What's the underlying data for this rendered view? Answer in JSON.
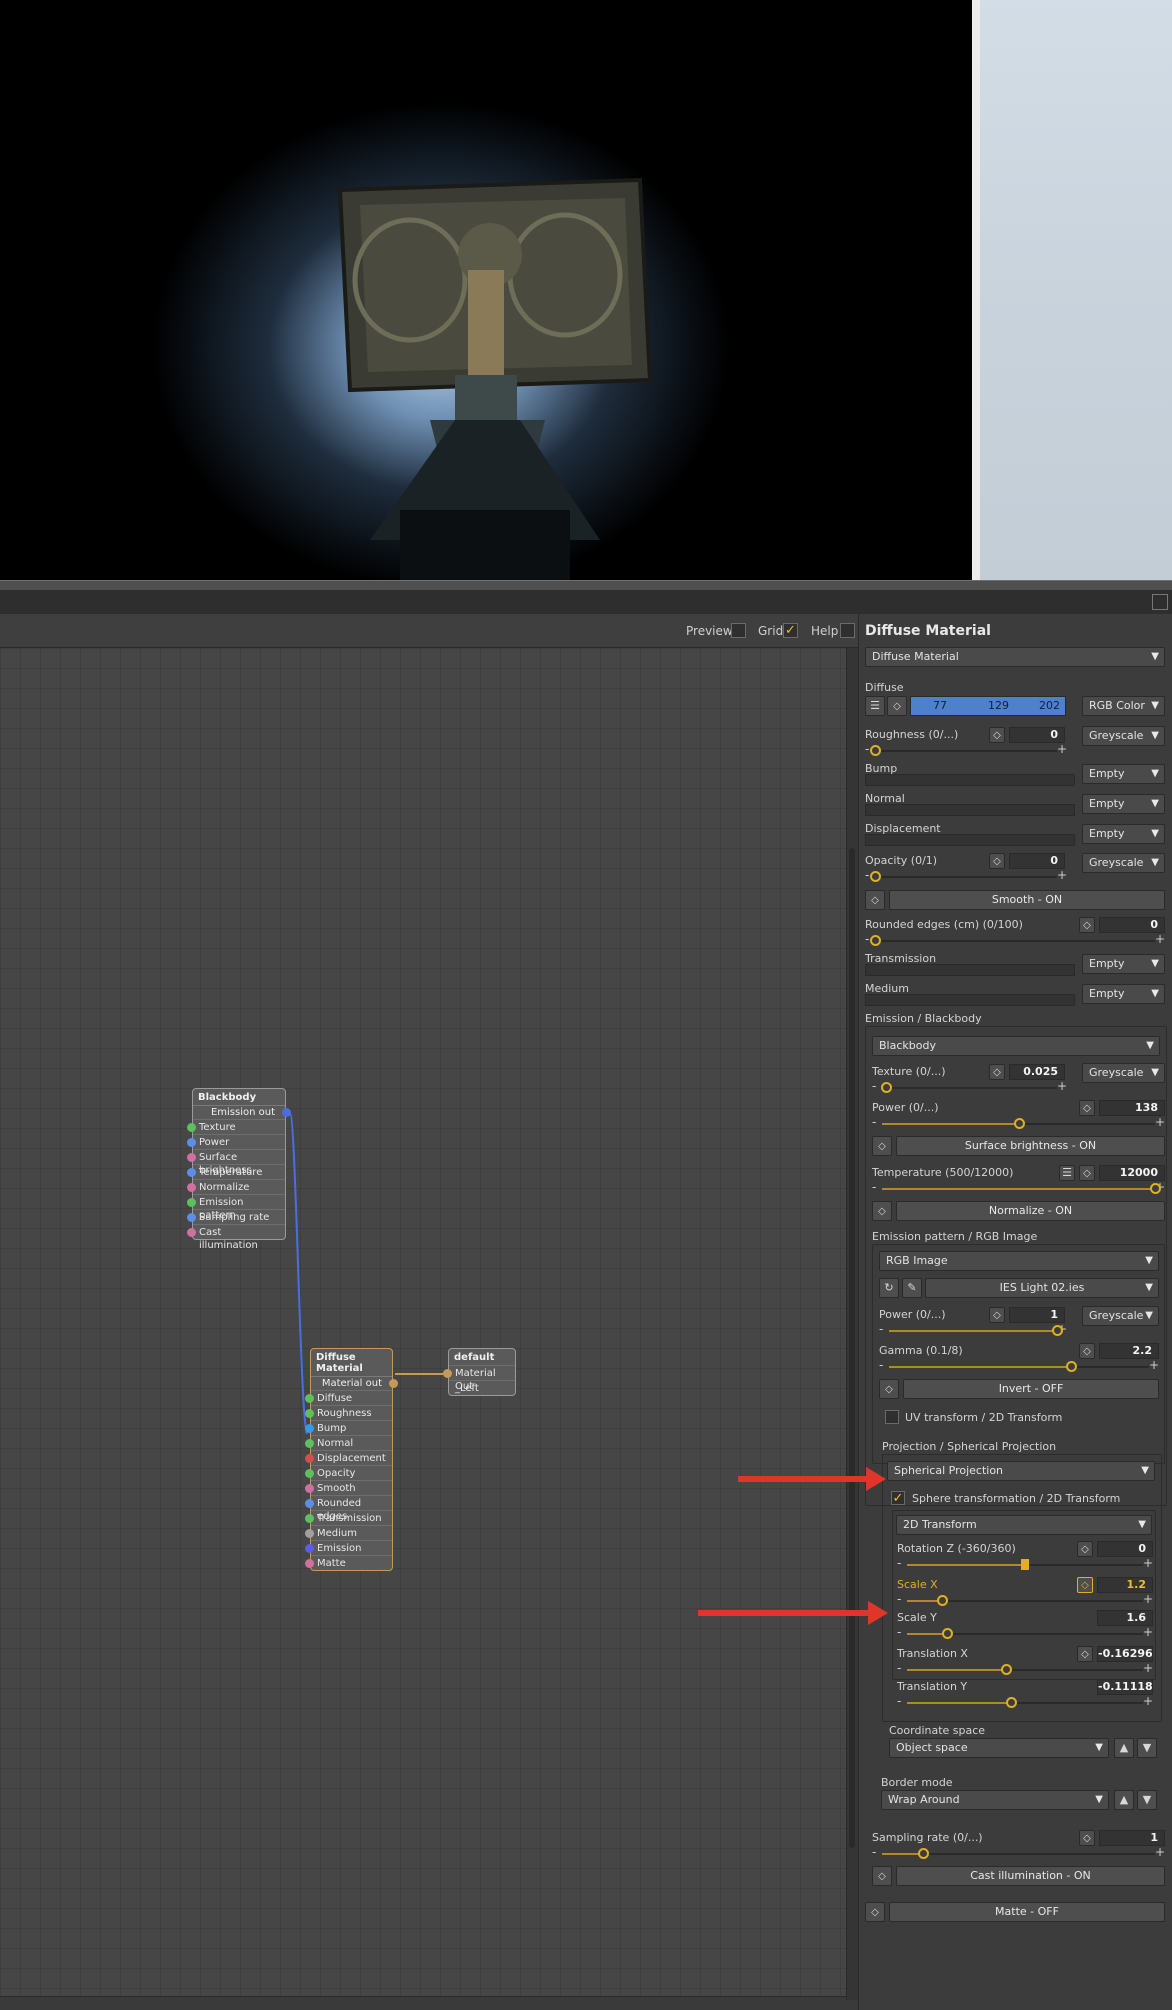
{
  "toolbar": {
    "preview_label": "Preview",
    "grid_label": "Grid",
    "help_label": "Help"
  },
  "nodes": {
    "blackbody": {
      "title": "Blackbody",
      "output": "Emission out",
      "inputs": [
        "Texture",
        "Power",
        "Surface brightness",
        "Temperature",
        "Normalize",
        "Emission pattern",
        "Sampling rate",
        "Cast illumination"
      ],
      "port_colors": [
        "#5cc05c",
        "#5c8ee8",
        "#d070a0",
        "#5c8ee8",
        "#d070a0",
        "#5cc05c",
        "#5c8ee8",
        "#d070a0"
      ]
    },
    "diffuse": {
      "title": "Diffuse Material",
      "output": "Material out",
      "inputs": [
        "Diffuse",
        "Roughness",
        "Bump",
        "Normal",
        "Displacement",
        "Opacity",
        "Smooth",
        "Rounded edges",
        "Transmission",
        "Medium",
        "Emission",
        "Matte"
      ],
      "port_colors": [
        "#5cc05c",
        "#5cc05c",
        "#3a9ae0",
        "#5cc05c",
        "#d05050",
        "#5cc05c",
        "#d070a0",
        "#5c8ee8",
        "#5cc05c",
        "#a0a0a0",
        "#5c5ce8",
        "#d070a0"
      ]
    },
    "output": {
      "title": "default",
      "output": "Material Out",
      "extra": "_Left"
    }
  },
  "panel": {
    "title": "Diffuse Material",
    "material_dropdown": "Diffuse Material",
    "diffuse": {
      "label": "Diffuse",
      "r": "77",
      "g": "129",
      "b": "202",
      "type": "RGB Color",
      "color": "#4d81ca"
    },
    "roughness": {
      "label": "Roughness (0/...)",
      "value": "0",
      "type": "Greyscale",
      "fraction": 0.0
    },
    "bump": {
      "label": "Bump",
      "type": "Empty"
    },
    "normal": {
      "label": "Normal",
      "type": "Empty"
    },
    "displacement": {
      "label": "Displacement",
      "type": "Empty"
    },
    "opacity": {
      "label": "Opacity (0/1)",
      "value": "0",
      "type": "Greyscale",
      "fraction": 0.0
    },
    "smooth_button": "Smooth - ON",
    "rounded_edges": {
      "label": "Rounded edges (cm) (0/100)",
      "value": "0",
      "fraction": 0.0
    },
    "transmission": {
      "label": "Transmission",
      "type": "Empty"
    },
    "medium": {
      "label": "Medium",
      "type": "Empty"
    },
    "emission": {
      "header": "Emission / Blackbody",
      "type": "Blackbody",
      "texture": {
        "label": "Texture (0/...)",
        "value": "0.025",
        "type": "Greyscale",
        "fraction": 0.025
      },
      "power": {
        "label": "Power (0/...)",
        "value": "138",
        "fraction": 0.5
      },
      "surface_button": "Surface brightness - ON",
      "temperature": {
        "label": "Temperature (500/12000)",
        "value": "12000",
        "fraction": 1.0
      },
      "normalize_button": "Normalize - ON",
      "pattern_header": "Emission pattern / RGB Image",
      "pattern_type": "RGB Image",
      "ies_file": "IES Light 02.ies",
      "pattern_power": {
        "label": "Power (0/...)",
        "value": "1",
        "type": "Greyscale",
        "fraction": 1.0
      },
      "gamma": {
        "label": "Gamma (0.1/8)",
        "value": "2.2",
        "fraction": 0.7
      },
      "invert_button": "Invert - OFF",
      "uv_transform": "UV transform / 2D Transform",
      "projection_header": "Projection / Spherical Projection",
      "projection_type": "Spherical Projection",
      "sphere_transform": "Sphere transformation / 2D Transform",
      "transform_type": "2D Transform",
      "rotation_z": {
        "label": "Rotation Z (-360/360)",
        "value": "0",
        "fraction": 0.5
      },
      "scale_x": {
        "label": "Scale X",
        "value": "1.2",
        "fraction": 0.15
      },
      "scale_y": {
        "label": "Scale Y",
        "value": "1.6",
        "fraction": 0.17
      },
      "translation_x": {
        "label": "Translation X",
        "value": "-0.16296",
        "fraction": 0.42
      },
      "translation_y": {
        "label": "Translation Y",
        "value": "-0.11118",
        "fraction": 0.44
      },
      "coordinate_space_label": "Coordinate space",
      "coordinate_space": "Object space",
      "border_mode_label": "Border mode",
      "border_mode": "Wrap Around",
      "sampling_rate": {
        "label": "Sampling rate (0/...)",
        "value": "1",
        "fraction": 0.15
      },
      "cast_button": "Cast illumination - ON"
    },
    "matte_button": "Matte - OFF"
  },
  "colors": {
    "accent": "#e0b020",
    "selection": "#4d81ca",
    "arrow": "#e0362a",
    "link_blue": "#4a6ee0",
    "link_orange": "#c49a5a"
  }
}
